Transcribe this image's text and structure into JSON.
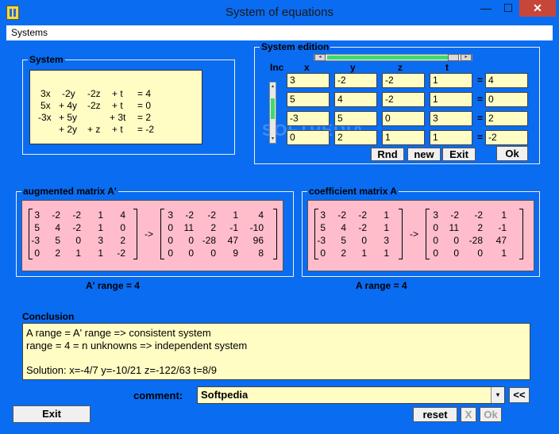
{
  "window": {
    "title": "System of equations",
    "min": "—",
    "max": "☐",
    "close": "✕"
  },
  "menu": {
    "systems": "Systems"
  },
  "system": {
    "legend": "System",
    "lines": [
      [
        "3x",
        "-2y",
        "-2z",
        "+ t",
        "= 4"
      ],
      [
        "5x",
        "+ 4y",
        "-2z",
        "+ t",
        "= 0"
      ],
      [
        "-3x",
        "+ 5y",
        "",
        "+ 3t",
        "= 2"
      ],
      [
        "",
        "+ 2y",
        "+ z",
        "+ t",
        "= -2"
      ]
    ]
  },
  "edition": {
    "legend": "System edition",
    "inc": "Inc",
    "headers": [
      "x",
      "y",
      "z",
      "t"
    ],
    "rows": [
      [
        "3",
        "-2",
        "-2",
        "1",
        "4"
      ],
      [
        "5",
        "4",
        "-2",
        "1",
        "0"
      ],
      [
        "-3",
        "5",
        "0",
        "3",
        "2"
      ],
      [
        "0",
        "2",
        "1",
        "1",
        "-2"
      ]
    ],
    "equals": "=",
    "buttons": {
      "rnd": "Rnd",
      "new": "new",
      "exit": "Exit",
      "ok": "Ok"
    },
    "slider_left": "◂",
    "slider_right": "▸",
    "scroll_up": "▴",
    "scroll_down": "▾"
  },
  "augmented": {
    "legend": "augmented matrix A'",
    "left": [
      [
        "3",
        "-2",
        "-2",
        "1",
        "4"
      ],
      [
        "5",
        "4",
        "-2",
        "1",
        "0"
      ],
      [
        "-3",
        "5",
        "0",
        "3",
        "2"
      ],
      [
        "0",
        "2",
        "1",
        "1",
        "-2"
      ]
    ],
    "arrow": "->",
    "right": [
      [
        "3",
        "-2",
        "-2",
        "1",
        "4"
      ],
      [
        "0",
        "11",
        "2",
        "-1",
        "-10"
      ],
      [
        "0",
        "0",
        "-28",
        "47",
        "96"
      ],
      [
        "0",
        "0",
        "0",
        "9",
        "8"
      ]
    ],
    "range": "A' range = 4"
  },
  "coefficient": {
    "legend": "coefficient matrix  A",
    "left": [
      [
        "3",
        "-2",
        "-2",
        "1"
      ],
      [
        "5",
        "4",
        "-2",
        "1"
      ],
      [
        "-3",
        "5",
        "0",
        "3"
      ],
      [
        "0",
        "2",
        "1",
        "1"
      ]
    ],
    "arrow": "->",
    "right": [
      [
        "3",
        "-2",
        "-2",
        "1"
      ],
      [
        "0",
        "11",
        "2",
        "-1"
      ],
      [
        "0",
        "0",
        "-28",
        "47"
      ],
      [
        "0",
        "0",
        "0",
        "1"
      ]
    ],
    "range": "A range = 4"
  },
  "conclusion": {
    "legend": "Conclusion",
    "line1": "A range = A' range => consistent system",
    "line2": " range = 4 = n unknowns => independent system",
    "line3": " Solution:   x=-4/7    y=-10/21    z=-122/63    t=8/9"
  },
  "comment": {
    "label": "comment:",
    "value": "Softpedia",
    "dropdown": "▾"
  },
  "footer": {
    "exit": "Exit",
    "prev": "<<",
    "reset": "reset",
    "cancel": "X",
    "ok": "Ok"
  },
  "watermark": "SOFTPEDIA"
}
